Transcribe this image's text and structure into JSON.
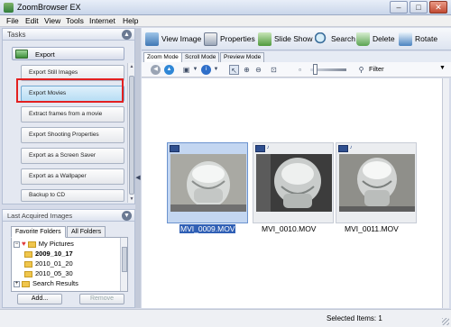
{
  "window": {
    "title": "ZoomBrowser EX",
    "min_label": "–",
    "max_label": "□",
    "close_label": "✕"
  },
  "menu": {
    "items": [
      "File",
      "Edit",
      "View",
      "Tools",
      "Internet",
      "Help"
    ]
  },
  "tasks": {
    "title": "Tasks",
    "section_label": "Export",
    "items": [
      "Export Still Images",
      "Export Movies",
      "Extract frames from a movie",
      "Export Shooting Properties",
      "Export as a Screen Saver",
      "Export as a Wallpaper",
      "Backup to CD"
    ],
    "selected_item": "Export Movies"
  },
  "last_acquired": {
    "title": "Last Acquired Images"
  },
  "favorites": {
    "tabs": [
      "Favorite Folders",
      "All Folders"
    ],
    "active_tab": "Favorite Folders",
    "tree": [
      "My Pictures",
      "2009_10_17",
      "2010_01_20",
      "2010_05_30",
      "Search Results"
    ],
    "add_label": "Add...",
    "remove_label": "Remove"
  },
  "toolbar": {
    "view_image": "View Image",
    "properties": "Properties",
    "slide_show": "Slide Show",
    "search": "Search",
    "delete": "Delete",
    "rotate": "Rotate"
  },
  "modes": {
    "tabs": [
      "Zoom Mode",
      "Scroll Mode",
      "Preview Mode"
    ],
    "active": "Zoom Mode"
  },
  "view_tools": {
    "filter_label": "Filter"
  },
  "thumbnails": [
    {
      "name": "MVI_0009.MOV",
      "selected": true
    },
    {
      "name": "MVI_0010.MOV",
      "selected": false
    },
    {
      "name": "MVI_0011.MOV",
      "selected": false
    }
  ],
  "status": {
    "text": "Selected Items: 1"
  },
  "colors": {
    "accent": "#2f5fb5",
    "highlight_box": "#e32020",
    "selection": "#c3d6f1"
  }
}
